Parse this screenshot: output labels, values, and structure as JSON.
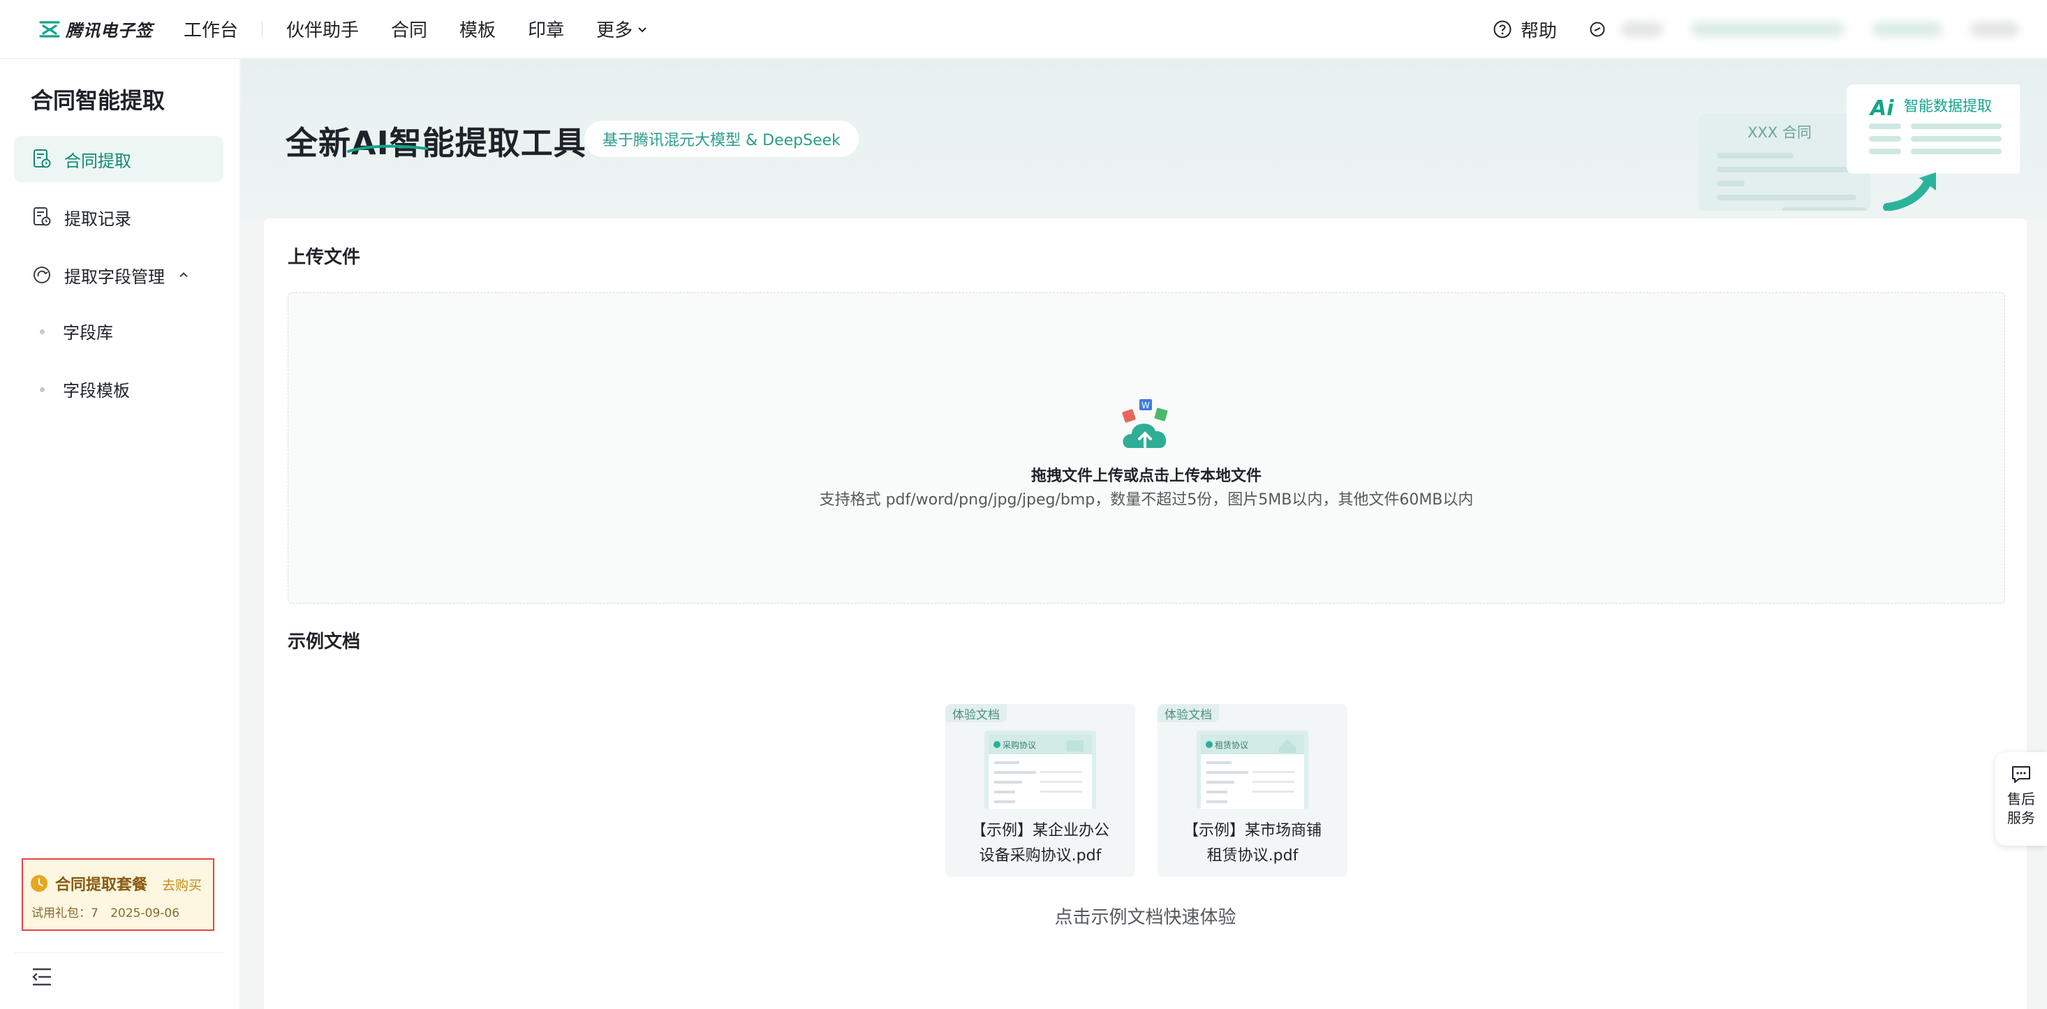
{
  "brand": {
    "name": "腾讯电子签"
  },
  "nav": {
    "workbench": "工作台",
    "items": [
      "伙伴助手",
      "合同",
      "模板",
      "印章"
    ],
    "more": "更多"
  },
  "topright": {
    "help": "帮助"
  },
  "sidebar": {
    "title": "合同智能提取",
    "items": [
      {
        "label": "合同提取",
        "icon": "contract-extract-icon",
        "active": true
      },
      {
        "label": "提取记录",
        "icon": "record-icon",
        "active": false
      },
      {
        "label": "提取字段管理",
        "icon": "field-manage-icon",
        "active": false,
        "expanded": true
      }
    ],
    "subitems": [
      "字段库",
      "字段模板"
    ],
    "plan": {
      "name": "合同提取套餐",
      "buy": "去购买",
      "trial": "试用礼包：7",
      "date": "2025-09-06"
    }
  },
  "hero": {
    "title": "全新AI智能提取工具",
    "badge": "基于腾讯混元大模型 & DeepSeek",
    "art_doc_label": "XXX 合同",
    "art_card_label": "智能数据提取"
  },
  "upload": {
    "section_title": "上传文件",
    "main_text": "拖拽文件上传或点击上传本地文件",
    "sub_text": "支持格式 pdf/word/png/jpg/jpeg/bmp，数量不超过5份，图片5MB以内，其他文件60MB以内"
  },
  "samples": {
    "section_title": "示例文档",
    "items": [
      {
        "tag": "体验文档",
        "thumb_title": "采购协议",
        "name_line1": "【示例】某企业办公",
        "name_line2": "设备采购协议.pdf"
      },
      {
        "tag": "体验文档",
        "thumb_title": "租赁协议",
        "name_line1": "【示例】某市场商铺",
        "name_line2": "租赁协议.pdf"
      }
    ],
    "hint": "点击示例文档快速体验"
  },
  "fab": {
    "line1": "售后",
    "line2": "服务"
  },
  "colors": {
    "accent": "#0f8a76",
    "accent_light": "#eef6f4",
    "warning_bg": "#fdf6e0",
    "highlight_border": "#e54545"
  }
}
